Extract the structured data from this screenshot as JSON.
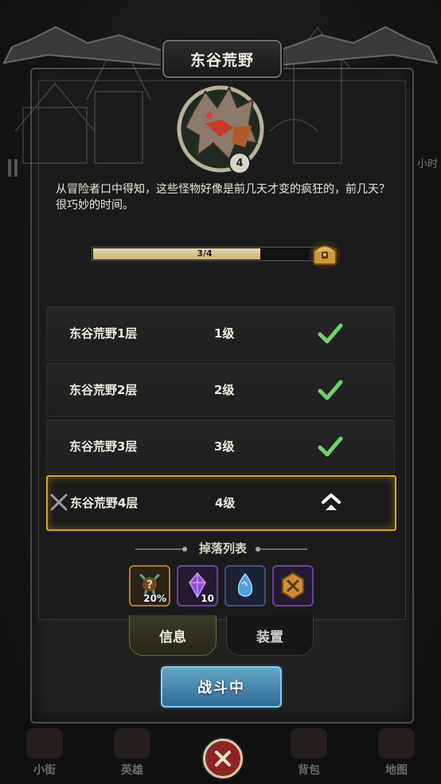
{
  "stage": {
    "title": "东谷荒野",
    "boss_level": "4",
    "description": "从冒险者口中得知，这些怪物好像是前几天才变的疯狂的，前几天？很巧妙的时间。"
  },
  "progress": {
    "current": 3,
    "total": 4,
    "label": "3/4",
    "fraction": 0.75
  },
  "floors": [
    {
      "name": "东谷荒野1层",
      "level": "1级",
      "status": "cleared"
    },
    {
      "name": "东谷荒野2层",
      "level": "2级",
      "status": "cleared"
    },
    {
      "name": "东谷荒野3层",
      "level": "3级",
      "status": "cleared"
    },
    {
      "name": "东谷荒野4层",
      "level": "4级",
      "status": "current"
    }
  ],
  "drops": {
    "title": "掉落列表",
    "items": [
      {
        "icon": "mystery-potion-icon",
        "qty": "20%",
        "color": "#b07a2d"
      },
      {
        "icon": "purple-gem-icon",
        "qty": "10",
        "color": "#6b3fa0"
      },
      {
        "icon": "blue-crystal-icon",
        "qty": "",
        "color": "#3f4f7a"
      },
      {
        "icon": "rune-medallion-icon",
        "qty": "",
        "color": "#6b3fa0"
      }
    ]
  },
  "tabs": {
    "info": "信息",
    "equip": "装置",
    "selected": "info"
  },
  "battle_button": "战斗中",
  "background": {
    "corner_text": "小时"
  },
  "bottom_nav": [
    {
      "label": "小街",
      "icon": "town-icon"
    },
    {
      "label": "英雄",
      "icon": "hero-icon"
    },
    {
      "label": "背包",
      "icon": "backpack-icon"
    },
    {
      "label": "地图",
      "icon": "map-icon"
    }
  ],
  "colors": {
    "accent_gold": "#d9a325",
    "check_green": "#6ed36e",
    "battle_blue": "#3f86b3",
    "close_red": "#8e2525"
  }
}
